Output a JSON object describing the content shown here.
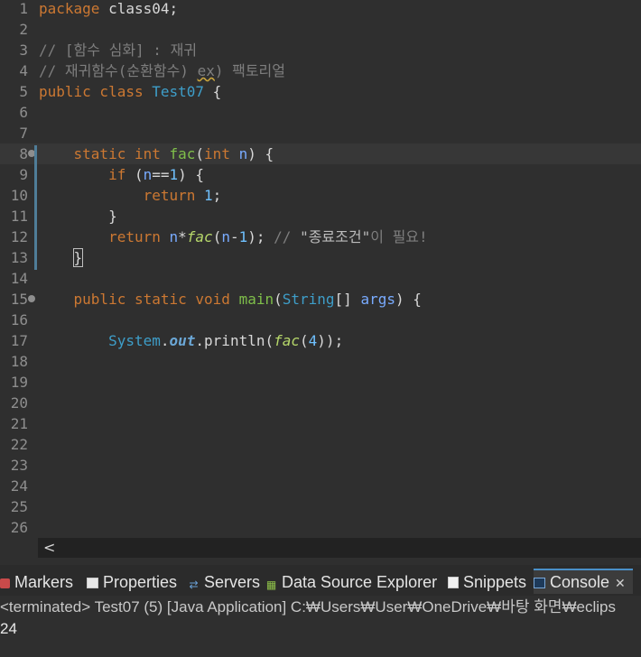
{
  "editor": {
    "lines": [
      {
        "n": "1"
      },
      {
        "n": "2"
      },
      {
        "n": "3"
      },
      {
        "n": "4"
      },
      {
        "n": "5"
      },
      {
        "n": "6"
      },
      {
        "n": "7"
      },
      {
        "n": "8"
      },
      {
        "n": "9"
      },
      {
        "n": "10"
      },
      {
        "n": "11"
      },
      {
        "n": "12"
      },
      {
        "n": "13"
      },
      {
        "n": "14"
      },
      {
        "n": "15"
      },
      {
        "n": "16"
      },
      {
        "n": "17"
      },
      {
        "n": "18"
      },
      {
        "n": "19"
      },
      {
        "n": "20"
      },
      {
        "n": "21"
      },
      {
        "n": "22"
      },
      {
        "n": "23"
      },
      {
        "n": "24"
      },
      {
        "n": "25"
      },
      {
        "n": "26"
      }
    ],
    "code": {
      "l1_kw": "package",
      "l1_rest": " class04;",
      "l3_comment": "// [함수 심화] : 재귀",
      "l4_comment_a": "// 재귀함수(순환함수) ",
      "l4_comment_b": "ex",
      "l4_comment_c": ") 팩토리얼",
      "l5_kw": "public class ",
      "l5_cls": "Test07",
      "l5_rest": " {",
      "l8_kw1": "static int ",
      "l8_fn": "fac",
      "l8_p1": "(",
      "l8_kw2": "int ",
      "l8_param": "n",
      "l8_p2": ") {",
      "l9_kw": "if",
      "l9_p1": " (",
      "l9_param": "n",
      "l9_op": "==",
      "l9_num": "1",
      "l9_p2": ") {",
      "l10_kw": "return ",
      "l10_num": "1",
      "l10_p": ";",
      "l11": "}",
      "l12_kw": "return ",
      "l12_param": "n",
      "l12_op": "*",
      "l12_fn": "fac",
      "l12_p1": "(",
      "l12_param2": "n",
      "l12_op2": "-",
      "l12_num": "1",
      "l12_p2": "); ",
      "l12_cmt1": "// ",
      "l12_str": "\"종료조건\"",
      "l12_cmt2": "이 필요!",
      "l13": "}",
      "l15_kw": "public static void ",
      "l15_fn": "main",
      "l15_p1": "(",
      "l15_cls": "String",
      "l15_p2": "[] ",
      "l15_param": "args",
      "l15_p3": ") {",
      "l17_cls": "System",
      "l17_dot1": ".",
      "l17_field": "out",
      "l17_call": ".println(",
      "l17_fn": "fac",
      "l17_p1": "(",
      "l17_num": "4",
      "l17_p2": "));"
    }
  },
  "scroll": {
    "left_arrow": "<"
  },
  "tabs": [
    {
      "label": "Markers",
      "icon": "markers-icon"
    },
    {
      "label": "Properties",
      "icon": "properties-icon"
    },
    {
      "label": "Servers",
      "icon": "servers-icon"
    },
    {
      "label": "Data Source Explorer",
      "icon": "data-source-icon"
    },
    {
      "label": "Snippets",
      "icon": "snippets-icon"
    },
    {
      "label": "Console",
      "icon": "console-icon",
      "active": true
    }
  ],
  "console": {
    "description": "<terminated> Test07 (5) [Java Application] C:₩Users₩User₩OneDrive₩바탕 화면₩eclips",
    "output": "24"
  },
  "colors": {
    "background": "#2f2f2f",
    "keyword": "#cc7832",
    "class": "#3e9ec9",
    "method": "#7fbf4a",
    "number": "#6fc1ff",
    "comment": "#7e7e7e",
    "change_bar": "#4f7d98"
  }
}
